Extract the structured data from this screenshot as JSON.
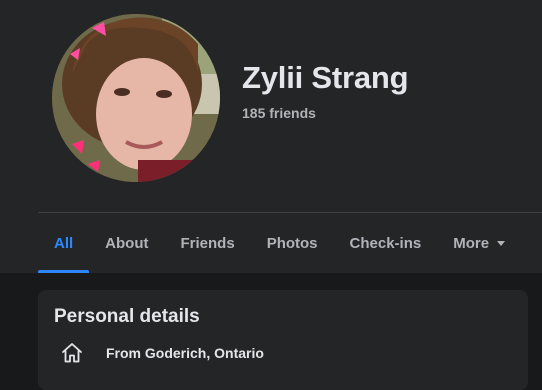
{
  "profile": {
    "name": "Zylii Strang",
    "friends_count": "185 friends"
  },
  "tabs": [
    {
      "label": "All",
      "active": true
    },
    {
      "label": "About",
      "active": false
    },
    {
      "label": "Friends",
      "active": false
    },
    {
      "label": "Photos",
      "active": false
    },
    {
      "label": "Check-ins",
      "active": false
    },
    {
      "label": "More",
      "active": false,
      "icon": "caret-down-icon"
    }
  ],
  "personal_details": {
    "title": "Personal details",
    "hometown": {
      "icon": "home-icon",
      "text": "From Goderich, Ontario"
    }
  },
  "colors": {
    "background": "#18191a",
    "surface": "#242526",
    "accent": "#2d88ff",
    "text_primary": "#e4e6eb",
    "text_secondary": "#b0b3b8"
  }
}
